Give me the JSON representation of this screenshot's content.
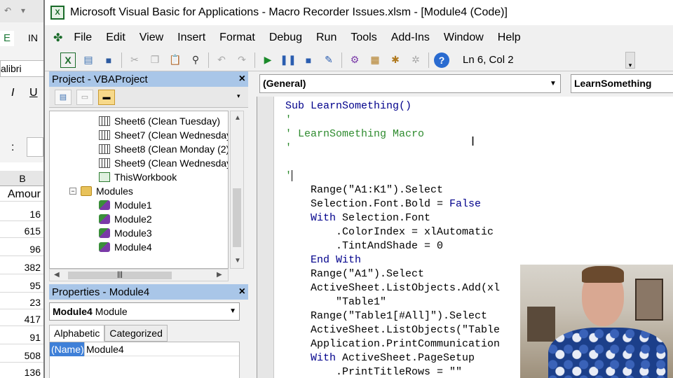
{
  "excel": {
    "ribbon_fragments": [
      "E",
      "IN",
      "alibri",
      "I",
      "U",
      ":"
    ],
    "column_header": "B",
    "column_label": "Amour",
    "cells": [
      "16",
      "615",
      "96",
      "382",
      "95",
      "23",
      "417",
      "91",
      "508",
      "136"
    ]
  },
  "window": {
    "title": "Microsoft Visual Basic for Applications - Macro Recorder Issues.xlsm - [Module4 (Code)]",
    "app_icon": "vba-icon"
  },
  "menu": {
    "items": [
      {
        "label": "File",
        "accel": "F"
      },
      {
        "label": "Edit",
        "accel": "E"
      },
      {
        "label": "View",
        "accel": "V"
      },
      {
        "label": "Insert",
        "accel": "I"
      },
      {
        "label": "Format",
        "accel": "o"
      },
      {
        "label": "Debug",
        "accel": "D"
      },
      {
        "label": "Run",
        "accel": "R"
      },
      {
        "label": "Tools",
        "accel": "T"
      },
      {
        "label": "Add-Ins",
        "accel": "A"
      },
      {
        "label": "Window",
        "accel": "W"
      },
      {
        "label": "Help",
        "accel": "H"
      }
    ]
  },
  "toolbar": {
    "status": "Ln 6, Col 2"
  },
  "project": {
    "title": "Project - VBAProject",
    "close": "×",
    "tree": [
      {
        "label": "Sheet6 (Clean Tuesday)",
        "icon": "sheet"
      },
      {
        "label": "Sheet7 (Clean Wednesday",
        "icon": "sheet"
      },
      {
        "label": "Sheet8 (Clean Monday (2)",
        "icon": "sheet"
      },
      {
        "label": "Sheet9 (Clean Wednesday",
        "icon": "sheet"
      },
      {
        "label": "ThisWorkbook",
        "icon": "workbook"
      },
      {
        "label": "Modules",
        "icon": "folder"
      },
      {
        "label": "Module1",
        "icon": "module"
      },
      {
        "label": "Module2",
        "icon": "module"
      },
      {
        "label": "Module3",
        "icon": "module"
      },
      {
        "label": "Module4",
        "icon": "module"
      }
    ]
  },
  "properties": {
    "title": "Properties - Module4",
    "close": "×",
    "object_name": "Module4",
    "object_type": "Module",
    "tabs": [
      "Alphabetic",
      "Categorized"
    ],
    "rows": [
      {
        "name": "(Name)",
        "value": "Module4"
      }
    ]
  },
  "code": {
    "object_combo": "(General)",
    "procedure_combo": "LearnSomething",
    "lines": [
      "Sub LearnSomething()",
      "'",
      "' LearnSomething Macro",
      "'",
      "",
      "'",
      "    Range(\"A1:K1\").Select",
      "    Selection.Font.Bold = False",
      "    With Selection.Font",
      "        .ColorIndex = xlAutomatic",
      "        .TintAndShade = 0",
      "    End With",
      "    Range(\"A1\").Select",
      "    ActiveSheet.ListObjects.Add(xl",
      "        \"Table1\"",
      "    Range(\"Table1[#All]\").Select",
      "    ActiveSheet.ListObjects(\"Table",
      "    Application.PrintCommunication",
      "    With ActiveSheet.PageSetup",
      "        .PrintTitleRows = \"\""
    ]
  }
}
